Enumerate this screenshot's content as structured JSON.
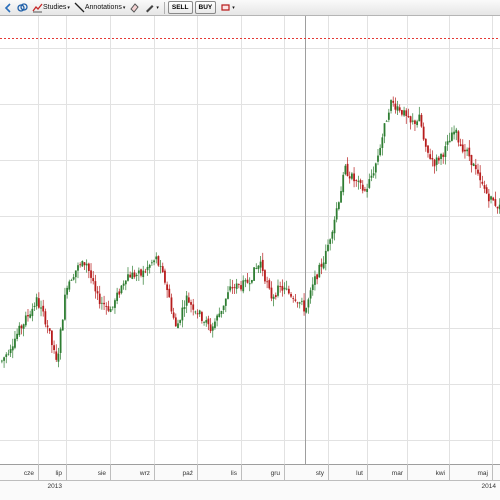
{
  "toolbar": {
    "studies_label": "Studies",
    "annotations_label": "Annotations",
    "sell_label": "SELL",
    "buy_label": "BUY",
    "caret": "▾"
  },
  "chart_data": {
    "type": "candlestick",
    "x_month_labels": [
      "cze",
      "lip",
      "sie",
      "wrz",
      "paź",
      "lis",
      "gru",
      "sty",
      "lut",
      "mar",
      "kwi",
      "maj"
    ],
    "x_year_labels": [
      "2013",
      "2014"
    ],
    "y_relative_range": [
      0,
      1
    ],
    "close_path": [
      [
        0,
        0.14
      ],
      [
        0.04,
        0.25
      ],
      [
        0.07,
        0.33
      ],
      [
        0.09,
        0.26
      ],
      [
        0.11,
        0.13
      ],
      [
        0.13,
        0.38
      ],
      [
        0.15,
        0.43
      ],
      [
        0.17,
        0.45
      ],
      [
        0.19,
        0.34
      ],
      [
        0.22,
        0.3
      ],
      [
        0.25,
        0.41
      ],
      [
        0.28,
        0.41
      ],
      [
        0.31,
        0.46
      ],
      [
        0.33,
        0.38
      ],
      [
        0.35,
        0.24
      ],
      [
        0.37,
        0.34
      ],
      [
        0.4,
        0.28
      ],
      [
        0.42,
        0.24
      ],
      [
        0.44,
        0.3
      ],
      [
        0.46,
        0.37
      ],
      [
        0.49,
        0.38
      ],
      [
        0.52,
        0.45
      ],
      [
        0.54,
        0.34
      ],
      [
        0.56,
        0.37
      ],
      [
        0.59,
        0.34
      ],
      [
        0.61,
        0.3
      ],
      [
        0.63,
        0.4
      ],
      [
        0.65,
        0.47
      ],
      [
        0.67,
        0.6
      ],
      [
        0.69,
        0.74
      ],
      [
        0.71,
        0.7
      ],
      [
        0.73,
        0.67
      ],
      [
        0.75,
        0.75
      ],
      [
        0.77,
        0.88
      ],
      [
        0.78,
        0.95
      ],
      [
        0.8,
        0.93
      ],
      [
        0.82,
        0.88
      ],
      [
        0.84,
        0.9
      ],
      [
        0.85,
        0.8
      ],
      [
        0.87,
        0.76
      ],
      [
        0.89,
        0.8
      ],
      [
        0.91,
        0.86
      ],
      [
        0.92,
        0.82
      ],
      [
        0.94,
        0.78
      ],
      [
        0.96,
        0.7
      ],
      [
        0.98,
        0.65
      ],
      [
        1.0,
        0.62
      ]
    ],
    "up_color": "#2e7d32",
    "down_color": "#b71c1c",
    "reference_line_color": "#e53935"
  }
}
